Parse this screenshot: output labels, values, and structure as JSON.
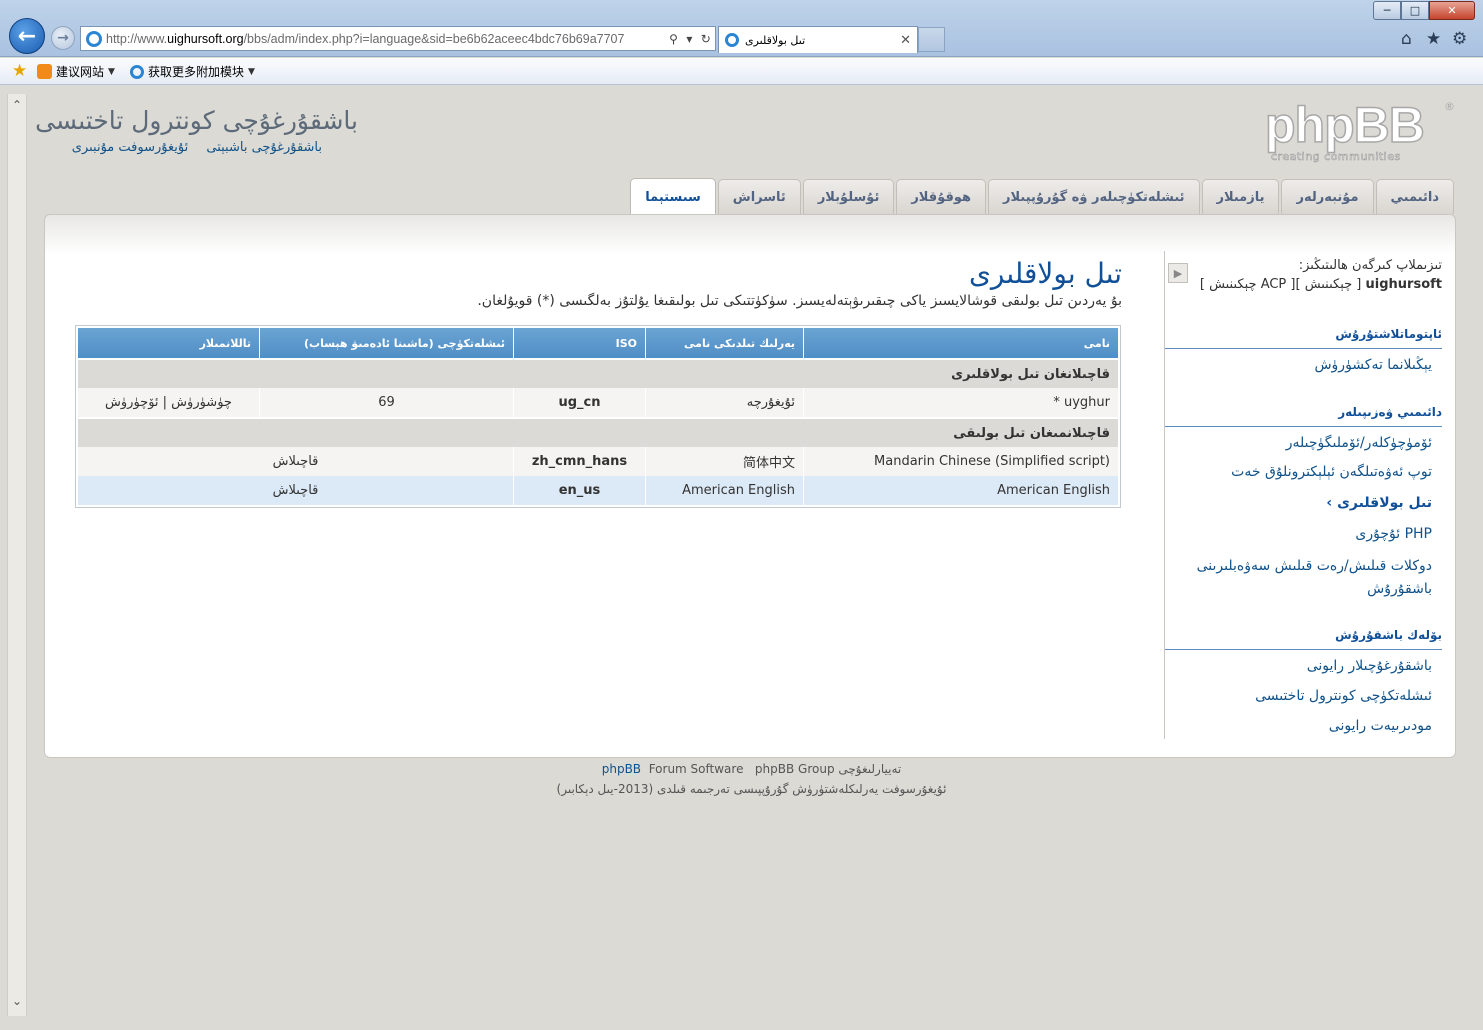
{
  "browser": {
    "url_prefix": "http://www.",
    "url_domain": "uighursoft.org",
    "url_rest": "/bbs/adm/index.php?i=language&sid=be6b62aceec4bdc76b69a7707",
    "tab_title": "تىل بولاقلىرى",
    "favorites": {
      "suggested": "建议网站",
      "addons": "获取更多附加模块"
    }
  },
  "header": {
    "site_title": "باشقۇرغۇچى كونترول تاختىسى",
    "link_index": "باشقۇرغۇچى باشبېتى",
    "link_board": "ئۇيغۇرسوفت مۇنبىرى",
    "logo_word": "phpBB",
    "logo_reg": "®",
    "logo_tag": "creating communities"
  },
  "tabs": [
    "دائىمىي",
    "مۇنبەرلەر",
    "يازمىلار",
    "ئىشلەتكۈچىلەر ۋە گۇرۇپپىلار",
    "ھوقۇقلار",
    "ئۇسلۇبلار",
    "ئاسراش",
    "سىستېما"
  ],
  "main": {
    "title": "تىل بولاقلىرى",
    "description": "بۇ يەردىن تىل بولىقى قوشالايسىز ياكى چىقىرىۋېتەلەيسىز. سۈكۈتتىكى تىل بولىقىغا يۇلتۇز بەلگىسى (*) قويۇلغان."
  },
  "table": {
    "headers": {
      "name": "نامى",
      "local_name": "يەرلىك تىلدىكى نامى",
      "iso": "ISO",
      "users": "ئىشلەتكۈچى (ماشىنا ئادەمىۋ ھېساب)",
      "actions": "تاللانمىلار"
    },
    "installed_label": "قاچىلانغان تىل بولاقلىرى",
    "installed": [
      {
        "name": "uyghur *",
        "local": "ئۇيغۇرچە",
        "iso": "ug_cn",
        "users": "69",
        "actions": "چۈشۈرۈش | ئۆچۈرۈش"
      }
    ],
    "uninstalled_label": "قاچىلانمىغان تىل بولىقى",
    "uninstalled": [
      {
        "name": "Mandarin Chinese (Simplified script)",
        "local": "简体中文",
        "iso": "zh_cmn_hans",
        "actions": "قاچىلاش"
      },
      {
        "name": "American English",
        "local": "American English",
        "iso": "en_us",
        "actions": "قاچىلاش"
      }
    ]
  },
  "sidebar": {
    "logged_label": "تىزىملاپ كىرگەن ھالىتىڭىز:",
    "username": "uighursoft",
    "user_links": "[ چېكىنىش ][ ACP چېكىنىش ]",
    "sections": [
      {
        "title": "ئاپتوماتلاشتۇرۇش",
        "items": [
          "يېڭىلانما تەكشۈرۈش"
        ]
      },
      {
        "title": "دائىمىي ۋەزىپىلەر",
        "items": [
          "ئۆمۈچۈكلەر/ئۆملىگۈچىلەر",
          "توپ ئەۋەتىلگەن ئېلېكترونلۇق خەت",
          "تىل بولاقلىرى",
          "PHP ئۇچۇرى",
          "دوكلات قىلىش/رەت قىلىش سەۋەبلىرىنى باشقۇرۇش"
        ]
      },
      {
        "title": "بۆلەك باشقۇرۇش",
        "items": [
          "باشقۇرغۇچىلار رايونى",
          "ئىشلەتكۈچى كونترول تاختىسى",
          "مودىرىيەت رايونى"
        ]
      }
    ],
    "current_item": "تىل بولاقلىرى"
  },
  "footer": {
    "powered_prefix": "phpBB",
    "powered_mid": "Forum Software",
    "powered_group": "phpBB Group تەييارلىغۇچى",
    "translation": "ئۇيغۇرسوفت يەرلىكلەشتۈرۈش گۇرۇپپىسى تەرجىمە قىلدى (2013-يىل دېكابىر)"
  }
}
